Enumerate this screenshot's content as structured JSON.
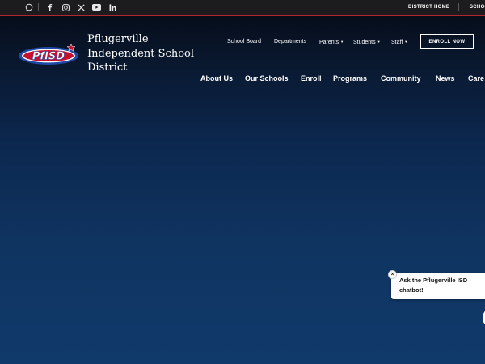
{
  "topbar": {
    "social_icons": [
      "whatsapp-icon",
      "facebook-icon",
      "instagram-icon",
      "x-twitter-icon",
      "youtube-icon",
      "linkedin-icon"
    ],
    "district_home": "DISTRICT HOME",
    "schools": "SCHOO"
  },
  "header": {
    "logo_text": "PfISD",
    "site_title": "Pflugerville Independent School District",
    "secondary_nav": [
      {
        "label": "School Board",
        "has_dropdown": false
      },
      {
        "label": "Departments",
        "has_dropdown": false
      },
      {
        "label": "Parents",
        "has_dropdown": true
      },
      {
        "label": "Students",
        "has_dropdown": true
      },
      {
        "label": "Staff",
        "has_dropdown": true
      }
    ],
    "enroll_button": "ENROLL NOW",
    "main_nav": [
      "About Us",
      "Our Schools",
      "Enroll",
      "Programs",
      "Community",
      "News",
      "Care"
    ]
  },
  "chatbot": {
    "message": "Ask the Pflugerville ISD chatbot!",
    "close": "×"
  },
  "colors": {
    "topbar_bg": "#1c1c1e",
    "accent_red": "#b3262f",
    "hero_blue": "#0f3460",
    "logo_red": "#c8102e",
    "logo_blue": "#1f4aa8"
  }
}
